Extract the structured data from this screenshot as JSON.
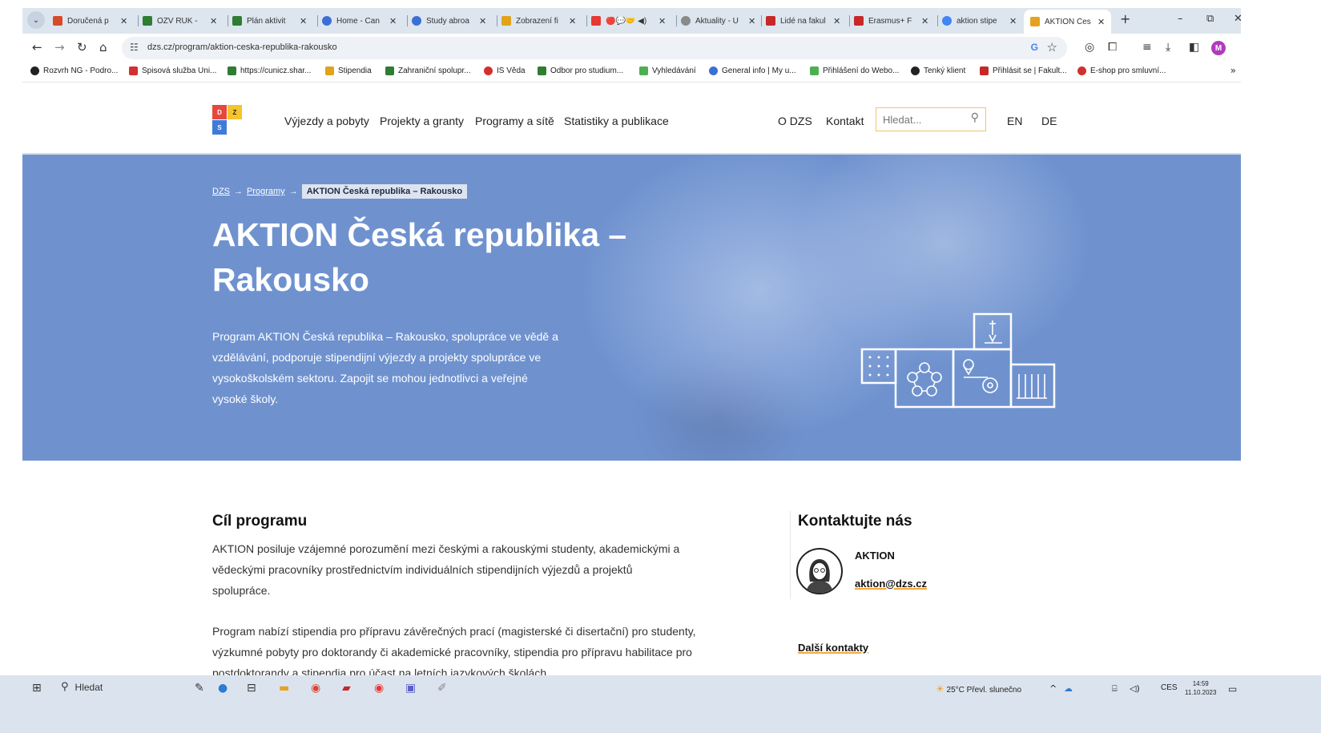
{
  "browser": {
    "tabs": [
      {
        "label": "Doručená p",
        "color": "#d64b2a"
      },
      {
        "label": "OZV RUK -",
        "color": "#2e7d32"
      },
      {
        "label": "Plán aktivit",
        "color": "#2e7d32"
      },
      {
        "label": "Home - Can",
        "color": "#3b6fd6"
      },
      {
        "label": "Study abroa",
        "color": "#3b6fd6"
      },
      {
        "label": "Zobrazení fi",
        "color": "#e0a31a"
      },
      {
        "label": "🔴💬🤝 ◀)",
        "color": "#e53935"
      },
      {
        "label": "Aktuality - U",
        "color": "#8a8a8a"
      },
      {
        "label": "Lidé na fakul",
        "color": "#c62828"
      },
      {
        "label": "Erasmus+ F",
        "color": "#c62828"
      },
      {
        "label": "aktion stipe",
        "color": "#4285f4"
      },
      {
        "label": "AKTION Čes",
        "color": "#e6a21f"
      }
    ],
    "new_tab": "+",
    "window_controls": {
      "minimize": "–",
      "maximize": "⧉",
      "close": "✕"
    },
    "url": "dzs.cz/program/aktion-ceska-republika-rakousko",
    "google_badge": "G",
    "profile_initial": "M",
    "bookmarks": [
      {
        "label": "Rozvrh NG - Podro...",
        "color": "#222222"
      },
      {
        "label": "Spisová služba Uni...",
        "color": "#d32f2f"
      },
      {
        "label": "https://cunicz.shar...",
        "color": "#2e7d32"
      },
      {
        "label": "Stipendia",
        "color": "#e0a31a"
      },
      {
        "label": "Zahraniční spolupr...",
        "color": "#2e7d32"
      },
      {
        "label": "IS Věda",
        "color": "#d32f2f"
      },
      {
        "label": "Odbor pro studium...",
        "color": "#2e7d32"
      },
      {
        "label": "Vyhledávání",
        "color": "#4caf50"
      },
      {
        "label": "General info | My u...",
        "color": "#3b6fd6"
      },
      {
        "label": "Přihlášení do Webo...",
        "color": "#4caf50"
      },
      {
        "label": "Tenký klient",
        "color": "#222222"
      },
      {
        "label": "Přihlásit se | Fakult...",
        "color": "#c62828"
      },
      {
        "label": "E-shop pro smluvní...",
        "color": "#d32f2f"
      }
    ]
  },
  "site": {
    "logo_letters": [
      "D",
      "Z",
      "S"
    ],
    "nav": [
      "Výjezdy a pobyty",
      "Projekty a granty",
      "Programy a sítě",
      "Statistiky a publikace"
    ],
    "nav_right": [
      "O DZS",
      "Kontakt"
    ],
    "search_placeholder": "Hledat...",
    "languages": [
      "EN",
      "DE"
    ]
  },
  "hero": {
    "breadcrumb": [
      "DZS",
      "Programy",
      "AKTION Česká republika – Rakousko"
    ],
    "breadcrumb_arrow": "→",
    "title": "AKTION Česká republika – Rakousko",
    "lead": "Program AKTION Česká republika – Rakousko, spolupráce ve vědě a vzdělávání, podporuje stipendijní výjezdy a projekty spolupráce ve vysokoškolském sektoru. Zapojit se mohou jednotlivci a veřejné vysoké školy."
  },
  "content": {
    "section_title": "Cíl programu",
    "para1": "AKTION posiluje vzájemné porozumění mezi českými a rakouskými studenty, akademickými a vědeckými pracovníky prostřednictvím individuálních stipendijních výjezdů a projektů spolupráce.",
    "para2": "Program nabízí stipendia pro přípravu závěrečných prací (magisterské či disertační) pro studenty, výzkumné pobyty pro doktorandy či akademické pracovníky, stipendia pro přípravu habilitace pro postdoktorandy a stipendia pro účast na letních jazykových školách.",
    "contact_title": "Kontaktujte nás",
    "contact_name": "AKTION",
    "contact_email": "aktion@dzs.cz",
    "more_contacts": "Další kontakty"
  },
  "taskbar": {
    "search_label": "Hledat",
    "weather": "25°C  Převl. slunečno",
    "language": "CES",
    "time": "14:59",
    "date": "11.10.2023"
  }
}
